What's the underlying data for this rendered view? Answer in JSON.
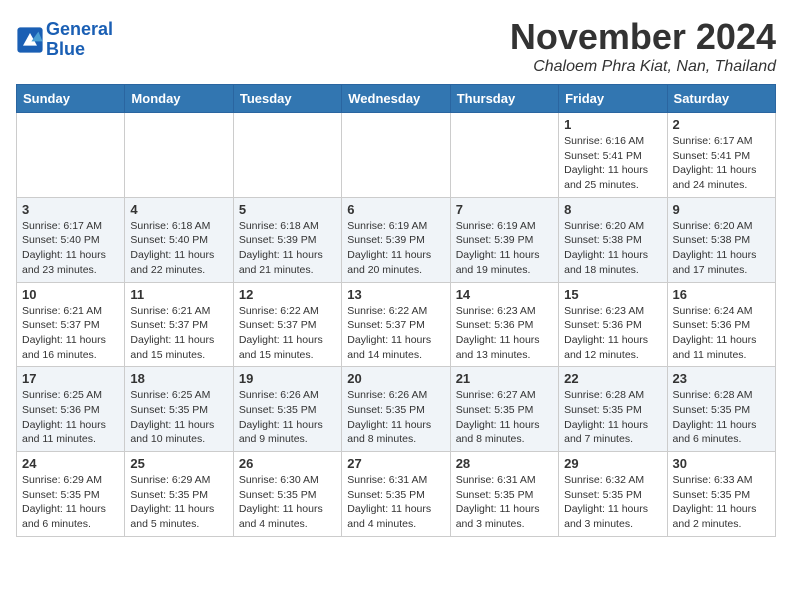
{
  "header": {
    "logo_line1": "General",
    "logo_line2": "Blue",
    "month_title": "November 2024",
    "location": "Chaloem Phra Kiat, Nan, Thailand"
  },
  "weekdays": [
    "Sunday",
    "Monday",
    "Tuesday",
    "Wednesday",
    "Thursday",
    "Friday",
    "Saturday"
  ],
  "weeks": [
    [
      {
        "day": "",
        "info": ""
      },
      {
        "day": "",
        "info": ""
      },
      {
        "day": "",
        "info": ""
      },
      {
        "day": "",
        "info": ""
      },
      {
        "day": "",
        "info": ""
      },
      {
        "day": "1",
        "info": "Sunrise: 6:16 AM\nSunset: 5:41 PM\nDaylight: 11 hours and 25 minutes."
      },
      {
        "day": "2",
        "info": "Sunrise: 6:17 AM\nSunset: 5:41 PM\nDaylight: 11 hours and 24 minutes."
      }
    ],
    [
      {
        "day": "3",
        "info": "Sunrise: 6:17 AM\nSunset: 5:40 PM\nDaylight: 11 hours and 23 minutes."
      },
      {
        "day": "4",
        "info": "Sunrise: 6:18 AM\nSunset: 5:40 PM\nDaylight: 11 hours and 22 minutes."
      },
      {
        "day": "5",
        "info": "Sunrise: 6:18 AM\nSunset: 5:39 PM\nDaylight: 11 hours and 21 minutes."
      },
      {
        "day": "6",
        "info": "Sunrise: 6:19 AM\nSunset: 5:39 PM\nDaylight: 11 hours and 20 minutes."
      },
      {
        "day": "7",
        "info": "Sunrise: 6:19 AM\nSunset: 5:39 PM\nDaylight: 11 hours and 19 minutes."
      },
      {
        "day": "8",
        "info": "Sunrise: 6:20 AM\nSunset: 5:38 PM\nDaylight: 11 hours and 18 minutes."
      },
      {
        "day": "9",
        "info": "Sunrise: 6:20 AM\nSunset: 5:38 PM\nDaylight: 11 hours and 17 minutes."
      }
    ],
    [
      {
        "day": "10",
        "info": "Sunrise: 6:21 AM\nSunset: 5:37 PM\nDaylight: 11 hours and 16 minutes."
      },
      {
        "day": "11",
        "info": "Sunrise: 6:21 AM\nSunset: 5:37 PM\nDaylight: 11 hours and 15 minutes."
      },
      {
        "day": "12",
        "info": "Sunrise: 6:22 AM\nSunset: 5:37 PM\nDaylight: 11 hours and 15 minutes."
      },
      {
        "day": "13",
        "info": "Sunrise: 6:22 AM\nSunset: 5:37 PM\nDaylight: 11 hours and 14 minutes."
      },
      {
        "day": "14",
        "info": "Sunrise: 6:23 AM\nSunset: 5:36 PM\nDaylight: 11 hours and 13 minutes."
      },
      {
        "day": "15",
        "info": "Sunrise: 6:23 AM\nSunset: 5:36 PM\nDaylight: 11 hours and 12 minutes."
      },
      {
        "day": "16",
        "info": "Sunrise: 6:24 AM\nSunset: 5:36 PM\nDaylight: 11 hours and 11 minutes."
      }
    ],
    [
      {
        "day": "17",
        "info": "Sunrise: 6:25 AM\nSunset: 5:36 PM\nDaylight: 11 hours and 11 minutes."
      },
      {
        "day": "18",
        "info": "Sunrise: 6:25 AM\nSunset: 5:35 PM\nDaylight: 11 hours and 10 minutes."
      },
      {
        "day": "19",
        "info": "Sunrise: 6:26 AM\nSunset: 5:35 PM\nDaylight: 11 hours and 9 minutes."
      },
      {
        "day": "20",
        "info": "Sunrise: 6:26 AM\nSunset: 5:35 PM\nDaylight: 11 hours and 8 minutes."
      },
      {
        "day": "21",
        "info": "Sunrise: 6:27 AM\nSunset: 5:35 PM\nDaylight: 11 hours and 8 minutes."
      },
      {
        "day": "22",
        "info": "Sunrise: 6:28 AM\nSunset: 5:35 PM\nDaylight: 11 hours and 7 minutes."
      },
      {
        "day": "23",
        "info": "Sunrise: 6:28 AM\nSunset: 5:35 PM\nDaylight: 11 hours and 6 minutes."
      }
    ],
    [
      {
        "day": "24",
        "info": "Sunrise: 6:29 AM\nSunset: 5:35 PM\nDaylight: 11 hours and 6 minutes."
      },
      {
        "day": "25",
        "info": "Sunrise: 6:29 AM\nSunset: 5:35 PM\nDaylight: 11 hours and 5 minutes."
      },
      {
        "day": "26",
        "info": "Sunrise: 6:30 AM\nSunset: 5:35 PM\nDaylight: 11 hours and 4 minutes."
      },
      {
        "day": "27",
        "info": "Sunrise: 6:31 AM\nSunset: 5:35 PM\nDaylight: 11 hours and 4 minutes."
      },
      {
        "day": "28",
        "info": "Sunrise: 6:31 AM\nSunset: 5:35 PM\nDaylight: 11 hours and 3 minutes."
      },
      {
        "day": "29",
        "info": "Sunrise: 6:32 AM\nSunset: 5:35 PM\nDaylight: 11 hours and 3 minutes."
      },
      {
        "day": "30",
        "info": "Sunrise: 6:33 AM\nSunset: 5:35 PM\nDaylight: 11 hours and 2 minutes."
      }
    ]
  ]
}
